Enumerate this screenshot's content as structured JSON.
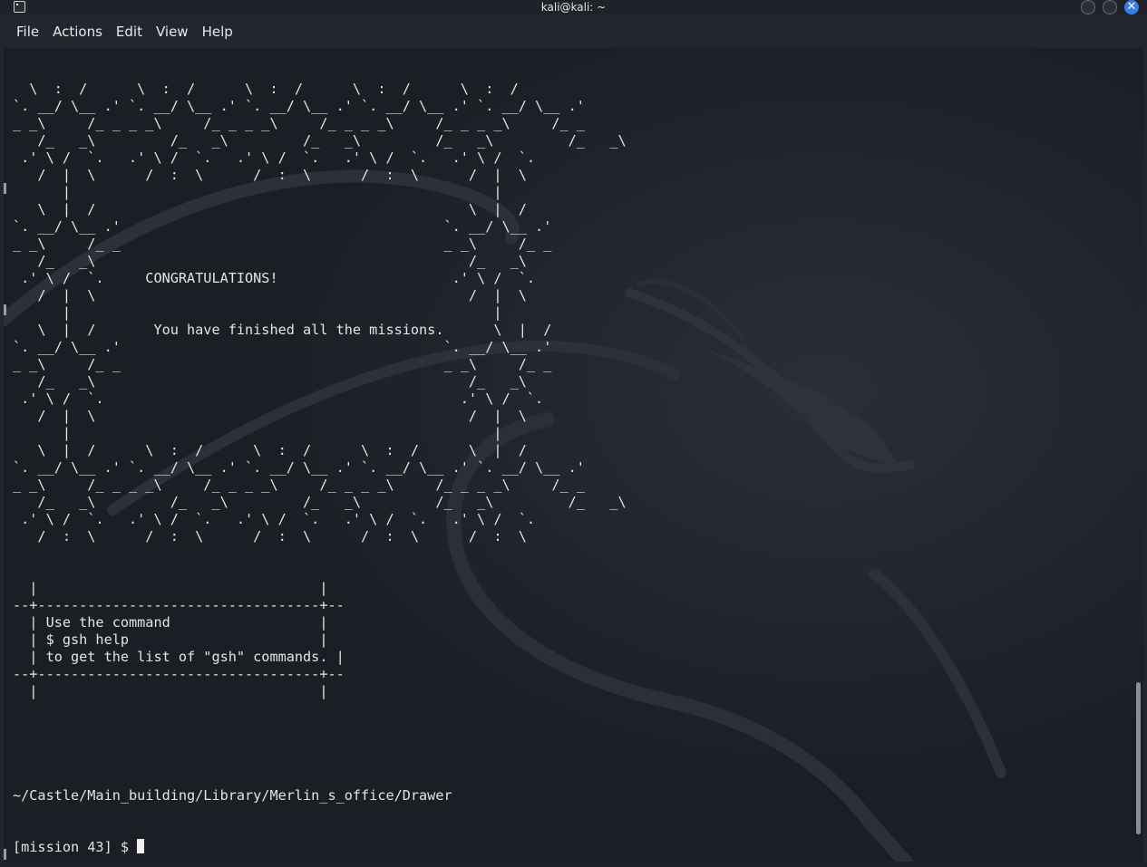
{
  "window": {
    "title": "kali@kali: ~",
    "terminal_icon": "terminal-icon",
    "minimize_icon": "minimize-icon",
    "maximize_icon": "maximize-icon",
    "close_icon": "close-icon",
    "close_glyph": "✕"
  },
  "menu": {
    "items": [
      "File",
      "Actions",
      "Edit",
      "View",
      "Help"
    ]
  },
  "terminal": {
    "output": "\n  \\  :  /      \\  :  /      \\  :  /      \\  :  /      \\  :  /\n`. __/ \\__ .' `. __/ \\__ .' `. __/ \\__ .' `. __/ \\__ .' `. __/ \\__ .'\n_ _\\     /_ _ _ _\\     /_ _ _ _\\     /_ _ _ _\\     /_ _ _ _\\     /_ _\n   /_   _\\         /_   _\\         /_   _\\         /_   _\\         /_   _\\\n .' \\ /  `.   .' \\ /  `.   .' \\ /  `.   .' \\ /  `.   .' \\ /  `.\n   /  |  \\      /  :  \\      /  :  \\      /  :  \\      /  |  \\\n      |                                                   |\n   \\  |  /                                             \\  |  /\n`. __/ \\__ .'                                       `. __/ \\__ .'\n_ _\\     /_ _                                       _ _\\     /_ _\n   /_   _\\                                             /_   _\\\n .' \\ /  `.     CONGRATULATIONS!                     .' \\ /  `.\n   /  |  \\                                             /  |  \\\n      |                                                   |\n   \\  |  /       You have finished all the missions.      \\  |  /\n`. __/ \\__ .'                                       `. __/ \\__ .'\n_ _\\     /_ _                                       _ _\\     /_ _\n   /_   _\\                                             /_   _\\\n .' \\ /  `.                                           .' \\ /  `.\n   /  |  \\                                             /  |  \\\n      |                                                   |\n   \\  |  /      \\  :  /      \\  :  /      \\  :  /      \\  |  /\n`. __/ \\__ .' `. __/ \\__ .' `. __/ \\__ .' `. __/ \\__ .' `. __/ \\__ .'\n_ _\\     /_ _ _ _\\     /_ _ _ _\\     /_ _ _ _\\     /_ _ _ _\\     /_ _\n   /_   _\\         /_   _\\         /_   _\\         /_   _\\         /_   _\\\n .' \\ /  `.   .' \\ /  `.   .' \\ /  `.   .' \\ /  `.   .' \\ /  `.\n   /  :  \\      /  :  \\      /  :  \\      /  :  \\      /  :  \\\n\n\n  |                                  |\n--+----------------------------------+--\n  | Use the command                  |\n  | $ gsh help                       |\n  | to get the list of \"gsh\" commands. |\n--+----------------------------------+--\n  |                                  |",
    "cwd": "~/Castle/Main_building/Library/Merlin_s_office/Drawer",
    "prompt": "[mission 43] $ "
  },
  "colors": {
    "background": "#1b1e25",
    "text": "#e4e4e4",
    "close_button": "#3a7be8"
  }
}
